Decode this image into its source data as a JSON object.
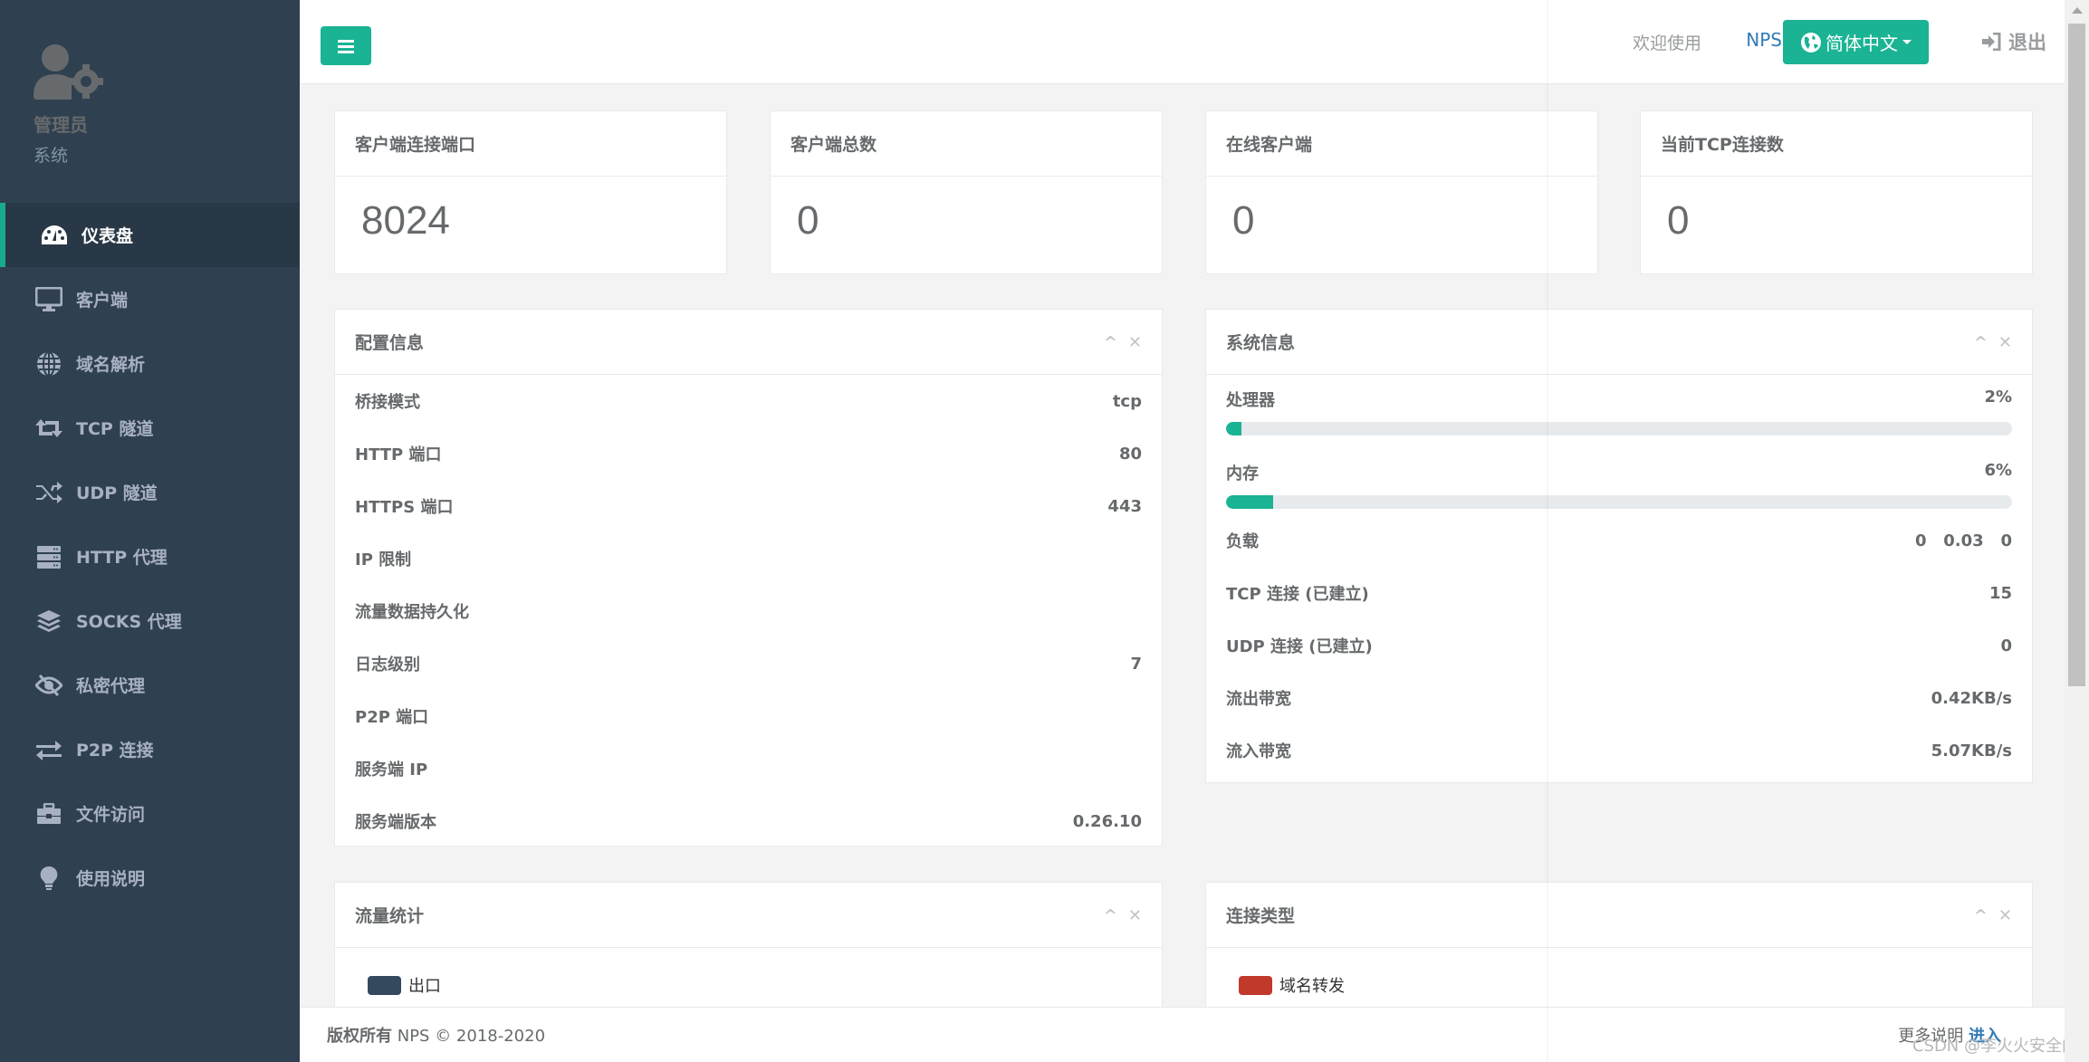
{
  "sidebar": {
    "profile": {
      "name": "管理员",
      "role": "系统",
      "icon": "user-gear-icon"
    },
    "items": [
      {
        "label": "仪表盘",
        "icon": "dashboard-icon",
        "active": true
      },
      {
        "label": "客户端",
        "icon": "desktop-icon"
      },
      {
        "label": "域名解析",
        "icon": "globe-icon"
      },
      {
        "label": "TCP 隧道",
        "icon": "retweet-icon"
      },
      {
        "label": "UDP 隧道",
        "icon": "random-icon"
      },
      {
        "label": "HTTP 代理",
        "icon": "server-icon"
      },
      {
        "label": "SOCKS 代理",
        "icon": "layers-icon"
      },
      {
        "label": "私密代理",
        "icon": "eye-slash-icon"
      },
      {
        "label": "P2P 连接",
        "icon": "exchange-icon"
      },
      {
        "label": "文件访问",
        "icon": "briefcase-icon"
      },
      {
        "label": "使用说明",
        "icon": "lightbulb-icon"
      }
    ]
  },
  "header": {
    "menu_icon": "bars-icon",
    "welcome": "欢迎使用",
    "brand": "NPS",
    "language": "简体中文",
    "logout": "退出"
  },
  "stats": [
    {
      "title": "客户端连接端口",
      "value": "8024"
    },
    {
      "title": "客户端总数",
      "value": "0"
    },
    {
      "title": "在线客户端",
      "value": "0"
    },
    {
      "title": "当前TCP连接数",
      "value": "0"
    }
  ],
  "config_panel": {
    "title": "配置信息",
    "rows": [
      {
        "label": "桥接模式",
        "value": "tcp"
      },
      {
        "label": "HTTP 端口",
        "value": "80"
      },
      {
        "label": "HTTPS 端口",
        "value": "443"
      },
      {
        "label": "IP 限制",
        "value": ""
      },
      {
        "label": "流量数据持久化",
        "value": ""
      },
      {
        "label": "日志级别",
        "value": "7"
      },
      {
        "label": "P2P 端口",
        "value": ""
      },
      {
        "label": "服务端 IP",
        "value": ""
      },
      {
        "label": "服务端版本",
        "value": "0.26.10"
      }
    ]
  },
  "system_panel": {
    "title": "系统信息",
    "cpu": {
      "label": "处理器",
      "value": "2%",
      "percent": 2
    },
    "memory": {
      "label": "内存",
      "value": "6%",
      "percent": 6
    },
    "rows": [
      {
        "label": "负载",
        "value": "0   0.03   0"
      },
      {
        "label": "TCP 连接 (已建立)",
        "value": "15"
      },
      {
        "label": "UDP 连接 (已建立)",
        "value": "0"
      },
      {
        "label": "流出带宽",
        "value": "0.42KB/s"
      },
      {
        "label": "流入带宽",
        "value": "5.07KB/s"
      }
    ]
  },
  "traffic_panel": {
    "title": "流量统计",
    "legend": [
      {
        "label": "出口",
        "color": "#34495e"
      }
    ]
  },
  "conn_panel": {
    "title": "连接类型",
    "legend": [
      {
        "label": "域名转发",
        "color": "#c0392b"
      }
    ]
  },
  "panel_tools": {
    "collapse": "^",
    "close": "✕"
  },
  "footer": {
    "copyright_label": "版权所有",
    "copyright_text": "NPS © 2018-2020",
    "more_label": "更多说明",
    "enter_link": "进入"
  },
  "watermark": "CSDN @李火火安全阁",
  "colors": {
    "accent": "#1ab394",
    "sidebar": "#2f4050",
    "link": "#337ab7"
  }
}
